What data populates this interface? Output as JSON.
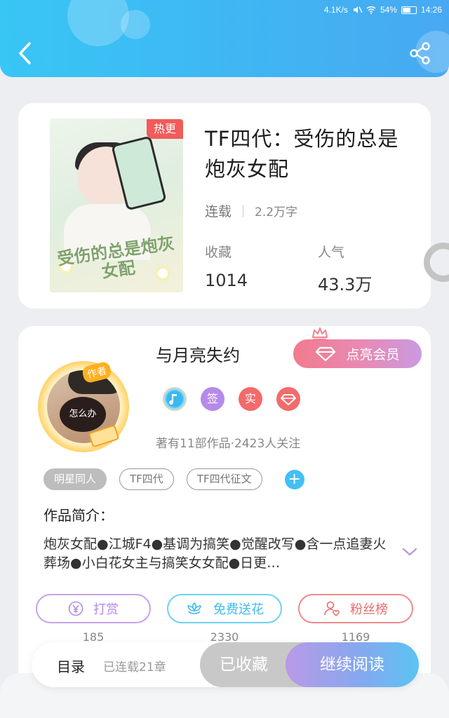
{
  "status_bar": {
    "speed": "4.1K/s",
    "battery": "54%",
    "time": "14:26"
  },
  "book": {
    "badge": "热更",
    "title": "TF四代：受伤的总是炮灰女配",
    "status": "连载",
    "word_count": "2.2万字",
    "favorites_label": "收藏",
    "favorites_value": "1014",
    "popularity_label": "人气",
    "popularity_value": "43.3万",
    "cover_text": "受伤的总是炮灰女配"
  },
  "author": {
    "name": "与月亮失约",
    "tag": "作者",
    "avatar_caption": "怎么办",
    "vip_button": "点亮会员",
    "badges": [
      "签",
      "实"
    ],
    "stats": "著有11部作品·2423人关注"
  },
  "tags": [
    "明星同人",
    "TF四代",
    "TF四代征文"
  ],
  "intro": {
    "title": "作品简介：",
    "text": "炮灰女配●江城F4●基调为搞笑●觉醒改写●含一点追妻火葬场●小白花女主与搞笑女女配●日更…"
  },
  "actions": [
    {
      "label": "打赏",
      "count": "185"
    },
    {
      "label": "免费送花",
      "count": "2330"
    },
    {
      "label": "粉丝榜",
      "count": "1169"
    }
  ],
  "bottom": {
    "toc": "目录",
    "chapters": "已连载21章",
    "favorited": "已收藏",
    "continue": "继续阅读"
  },
  "colors": {
    "header_blue": "#3fb7f3",
    "hot_red": "#f25b5b",
    "accent_purple": "#b58ae8",
    "accent_cyan": "#43c0f3"
  }
}
